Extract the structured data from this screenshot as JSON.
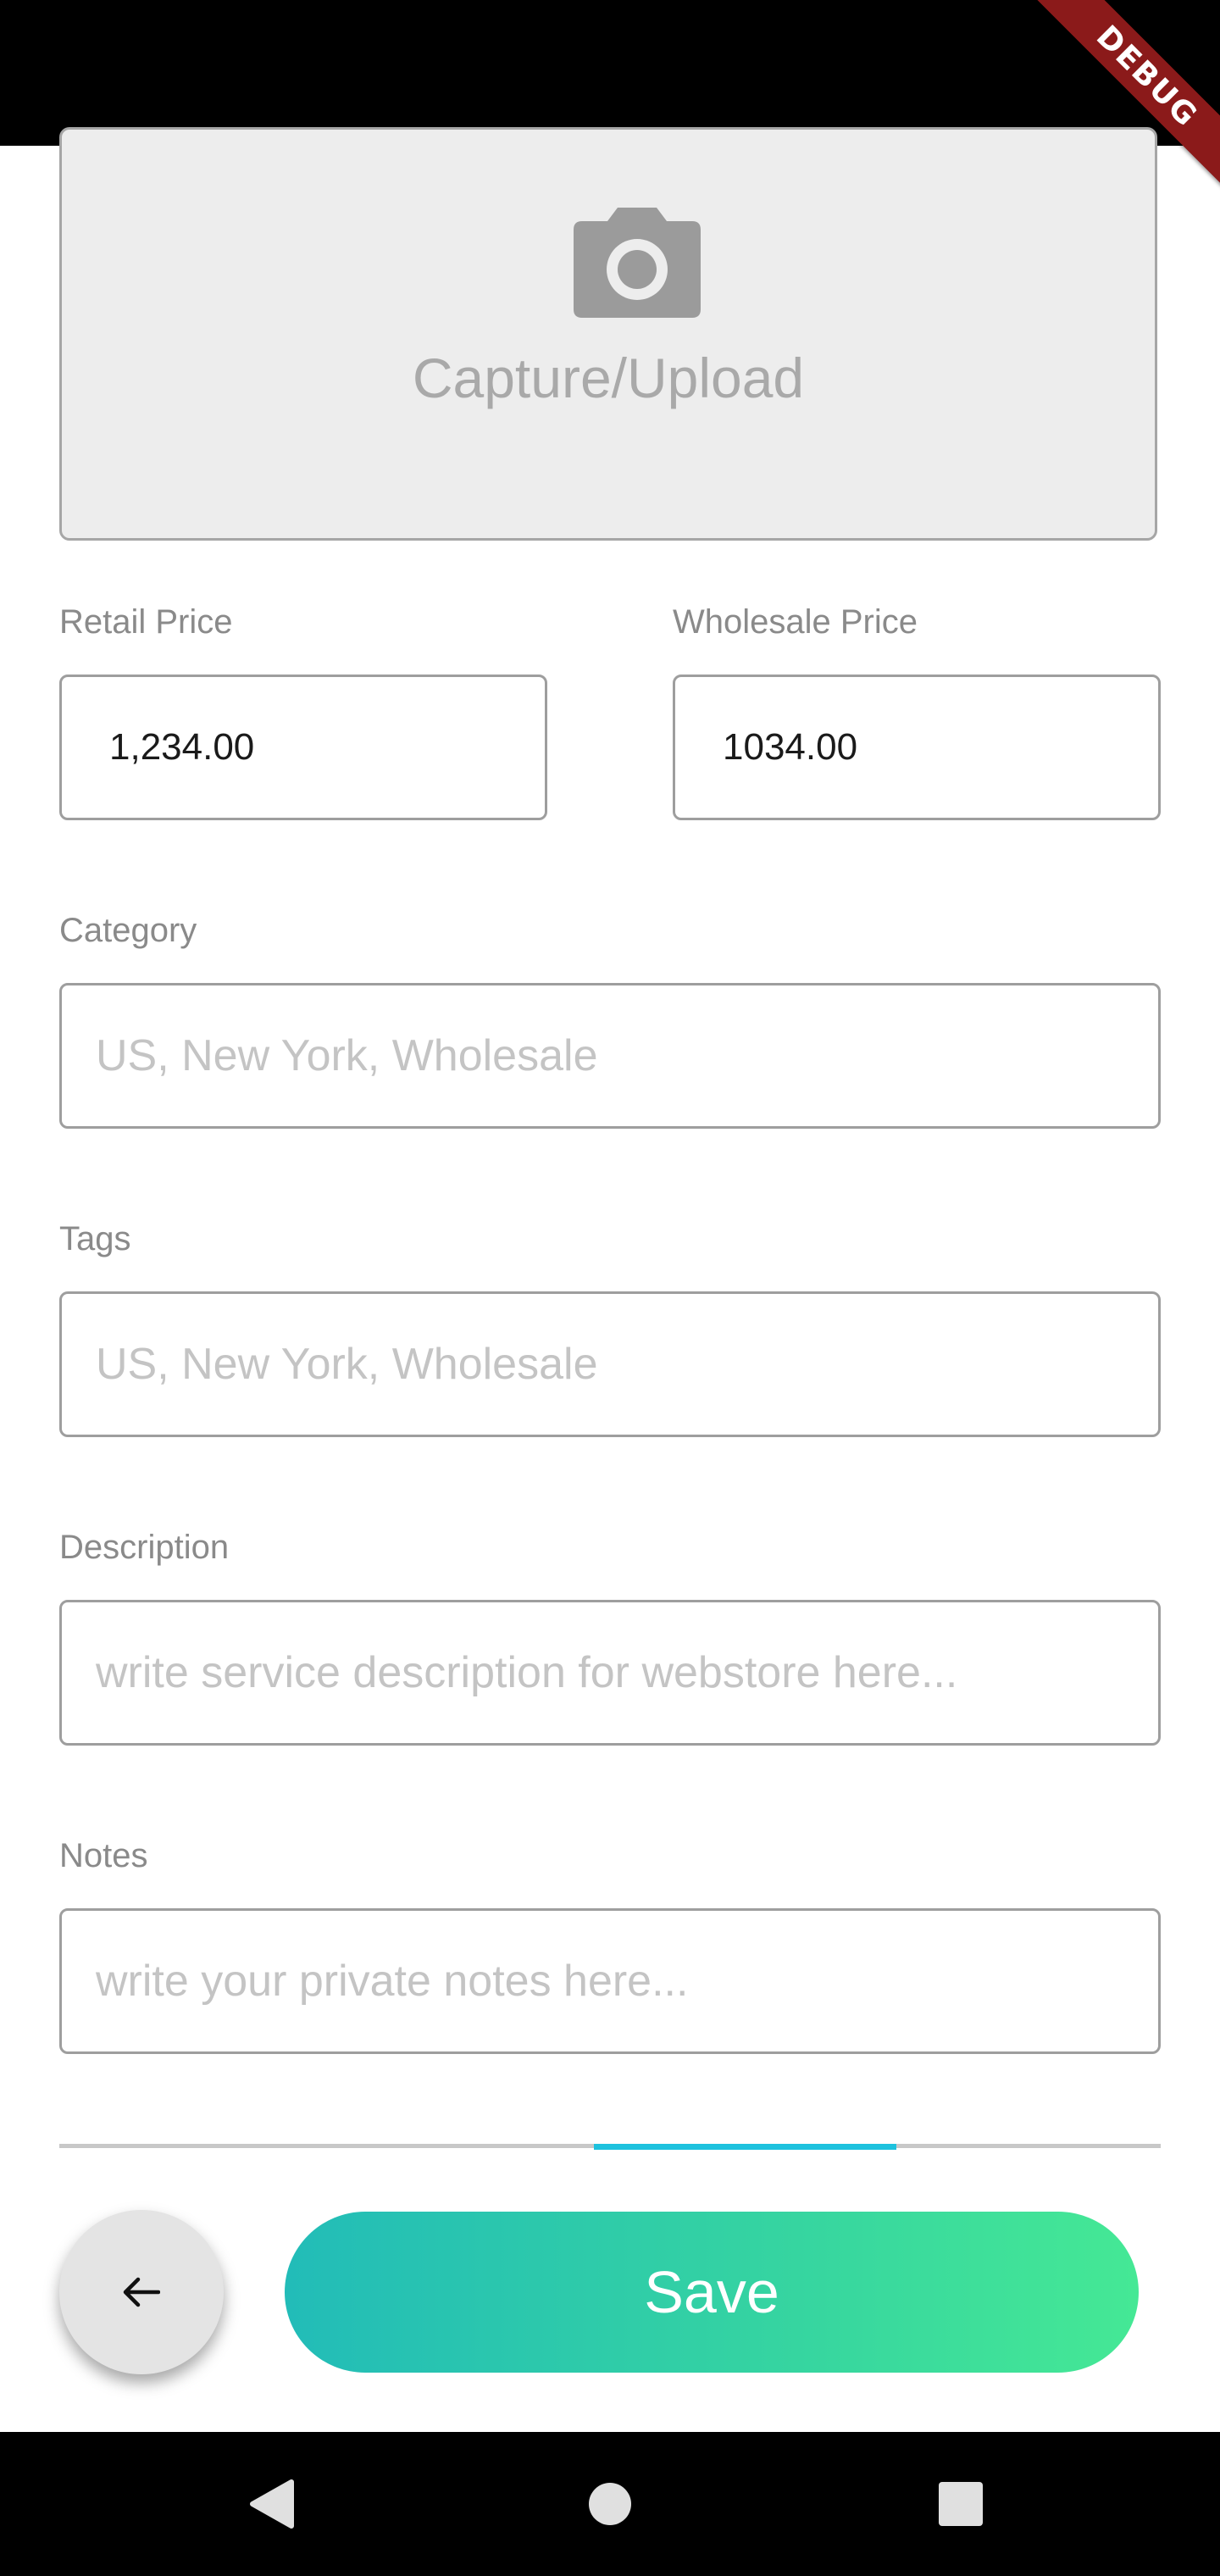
{
  "debug_banner": "DEBUG",
  "photo": {
    "label": "Capture/Upload",
    "icon": "camera-icon"
  },
  "retail_price": {
    "label": "Retail Price",
    "value": "1,234.00"
  },
  "wholesale_price": {
    "label": "Wholesale Price",
    "value": "1034.00"
  },
  "category": {
    "label": "Category",
    "placeholder": "US, New York, Wholesale"
  },
  "tags": {
    "label": "Tags",
    "placeholder": "US, New York, Wholesale"
  },
  "description": {
    "label": "Description",
    "placeholder": "write service description for webstore here..."
  },
  "notes": {
    "label": "Notes",
    "placeholder": "write your private notes here..."
  },
  "progress": {
    "start_fraction": 0.485,
    "end_fraction": 0.76
  },
  "actions": {
    "back_icon": "arrow-back-icon",
    "save_label": "Save"
  },
  "colors": {
    "accent": "#1ec2de",
    "save_gradient_start": "#22bcb8",
    "save_gradient_end": "#45e895"
  },
  "nav": {
    "back_icon": "triangle-back-icon",
    "home_icon": "circle-home-icon",
    "recents_icon": "square-recents-icon"
  }
}
